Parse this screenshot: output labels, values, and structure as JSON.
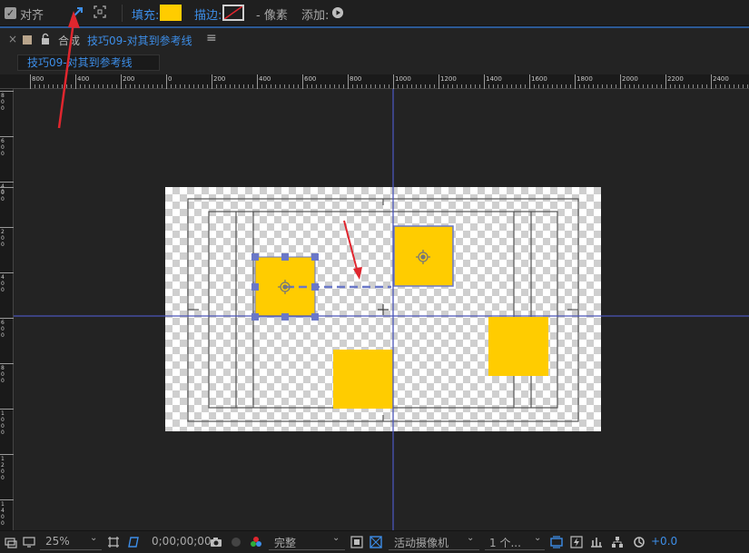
{
  "toolbar": {
    "align_label": "对齐",
    "fill_label": "填充:",
    "stroke_label": "描边:",
    "pixel_label": "- 像素",
    "add_label": "添加:",
    "fill_color": "#ffcc00"
  },
  "panel": {
    "close": "×",
    "comp_prefix": "合成",
    "comp_name": "技巧09-对其到参考线",
    "menu": "≡"
  },
  "tab": {
    "label": "技巧09-对其到参考线"
  },
  "ruler": {
    "top_labels": [
      "800",
      "400",
      "200",
      "0",
      "200",
      "400",
      "600",
      "800",
      "1000",
      "1200",
      "1400",
      "1600",
      "1800",
      "2000",
      "2200",
      "2400"
    ],
    "left_labels": [
      "800",
      "600",
      "400",
      "0",
      "200",
      "400",
      "600",
      "800",
      "1000",
      "1200",
      "1400"
    ]
  },
  "bottom": {
    "zoom": "25%",
    "timecode": "0;00;00;00",
    "resolution": "完整",
    "camera": "活动摄像机",
    "views": "1 个...",
    "exposure": "+0.0"
  },
  "colors": {
    "accent": "#3d8ee8",
    "shape_fill": "#ffcc00",
    "guide": "#4a55b8",
    "annotation": "#e0262e"
  }
}
